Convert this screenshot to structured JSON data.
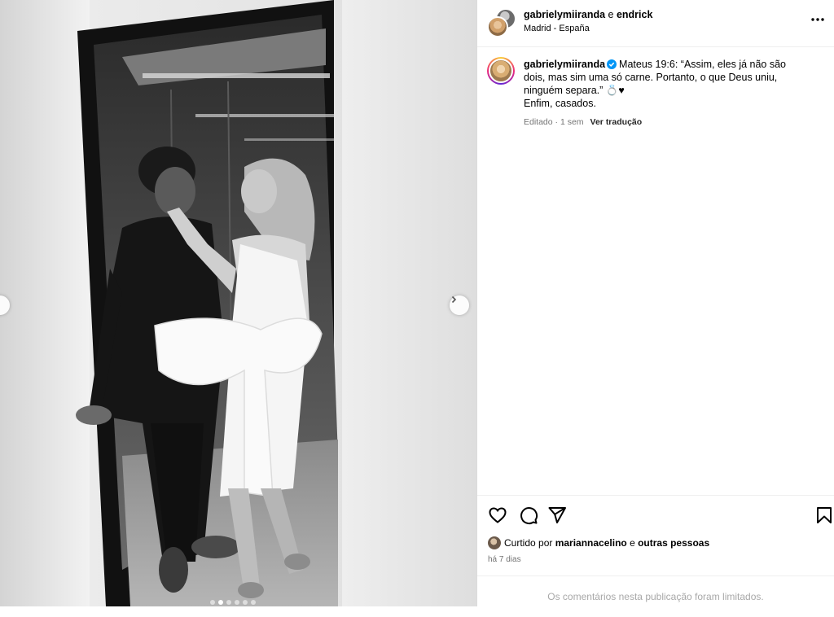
{
  "header": {
    "author": "gabrielymiiranda",
    "conjunction": " e ",
    "coauthor": "endrick",
    "location": "Madrid - España"
  },
  "caption": {
    "username": "gabrielymiiranda",
    "text_line1": "Mateus 19:6: “Assim, eles já não são dois, mas sim uma só carne. Portanto, o que Deus uniu, ninguém separa.” 💍♥",
    "text_line2": "Enfim, casados.",
    "edited": "Editado · 1 sem",
    "translate": "Ver tradução"
  },
  "likes": {
    "prefix": "Curtido por ",
    "user": "mariannacelino",
    "middle": " e ",
    "others": "outras pessoas"
  },
  "timestamp": "há 7 dias",
  "comments_limited": "Os comentários nesta publicação foram limitados.",
  "carousel": {
    "total": 6,
    "active": 2
  },
  "icons": {
    "more": "more-options-icon",
    "like": "heart-icon",
    "comment": "comment-icon",
    "share": "send-icon",
    "save": "bookmark-icon",
    "next": "chevron-right-icon",
    "prev": "chevron-left-icon",
    "verified": "verified-badge-icon"
  },
  "colors": {
    "verified": "#0095f6",
    "muted": "#737373",
    "border": "#dbdbdb"
  }
}
